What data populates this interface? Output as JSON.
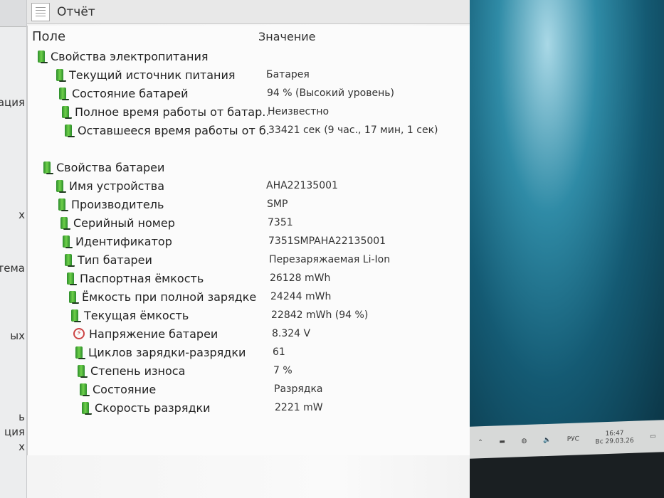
{
  "sidebar": {
    "fragments": [
      "мация",
      "х",
      "стема",
      "ых",
      "ь",
      "ция",
      "х"
    ]
  },
  "window": {
    "title": "Отчёт"
  },
  "columns": {
    "field": "Поле",
    "value": "Значение"
  },
  "sections": [
    {
      "title": "Свойства электропитания",
      "rows": [
        {
          "field": "Текущий источник питания",
          "value": "Батарея"
        },
        {
          "field": "Состояние батарей",
          "value": "94 % (Высокий уровень)"
        },
        {
          "field": "Полное время работы от батар...",
          "value": "Неизвестно"
        },
        {
          "field": "Оставшееся время работы от б...",
          "value": "33421 сек (9 час., 17 мин, 1 сек)"
        }
      ]
    },
    {
      "title": "Свойства батареи",
      "rows": [
        {
          "field": "Имя устройства",
          "value": "AHA22135001"
        },
        {
          "field": "Производитель",
          "value": "SMP"
        },
        {
          "field": "Серийный номер",
          "value": "7351"
        },
        {
          "field": "Идентификатор",
          "value": "7351SMPAHA22135001"
        },
        {
          "field": "Тип батареи",
          "value": "Перезаряжаемая Li-Ion"
        },
        {
          "field": "Паспортная ёмкость",
          "value": "26128 mWh"
        },
        {
          "field": "Ёмкость при полной зарядке",
          "value": "24244 mWh"
        },
        {
          "field": "Текущая ёмкость",
          "value": "22842 mWh  (94 %)"
        },
        {
          "field": "Напряжение батареи",
          "value": "8.324 V"
        },
        {
          "field": "Циклов зарядки-разрядки",
          "value": "61"
        },
        {
          "field": "Степень износа",
          "value": "7 %"
        },
        {
          "field": "Состояние",
          "value": "Разрядка"
        },
        {
          "field": "Скорость разрядки",
          "value": "2221 mW"
        }
      ]
    }
  ],
  "taskbar": {
    "language": "РУС",
    "time": "16:47",
    "date": "Вс 29.03.26"
  }
}
